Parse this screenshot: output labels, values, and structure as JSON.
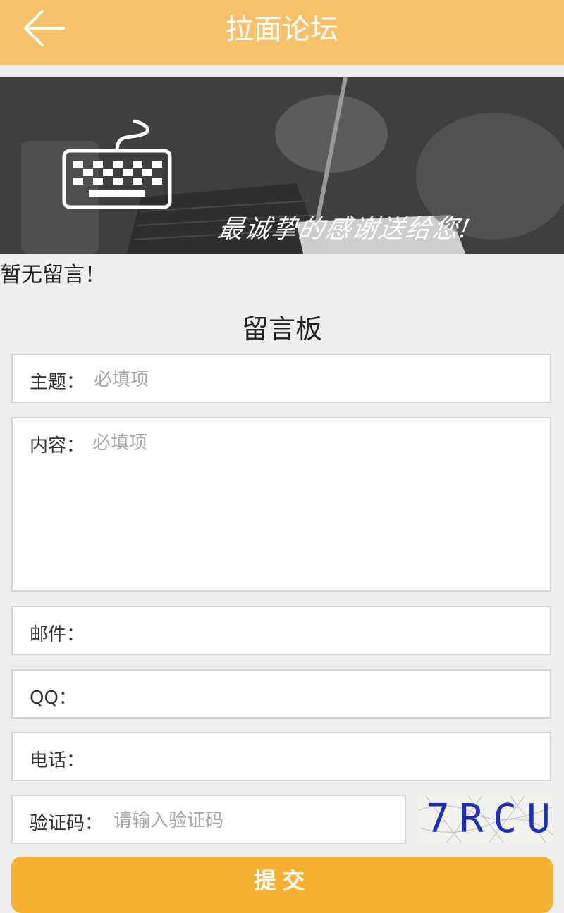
{
  "header": {
    "title": "拉面论坛",
    "back_icon": "arrow-left-icon",
    "bg_color": "#f6c169"
  },
  "banner": {
    "text": "最诚挚的感谢送给您!",
    "icon": "keyboard-icon"
  },
  "messages": {
    "empty_text": "暂无留言！"
  },
  "form": {
    "title": "留言板",
    "subject": {
      "label": "主题：",
      "placeholder": "必填项"
    },
    "content": {
      "label": "内容：",
      "placeholder": "必填项"
    },
    "email": {
      "label": "邮件："
    },
    "qq": {
      "label": "QQ："
    },
    "phone": {
      "label": "电话："
    },
    "captcha": {
      "label": "验证码：",
      "placeholder": "请输入验证码",
      "image_text": "7RCU"
    },
    "submit_label": "提交"
  },
  "colors": {
    "accent": "#f8b033",
    "border": "#d4d4d4",
    "captcha_text": "#1d2fb8"
  }
}
